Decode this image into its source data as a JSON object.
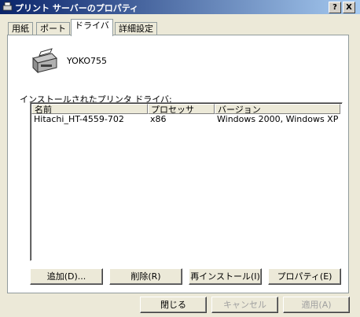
{
  "window": {
    "title": "プリント サーバーのプロパティ",
    "help_label": "?",
    "close_label": "X"
  },
  "tabs": [
    {
      "label": "用紙"
    },
    {
      "label": "ポート"
    },
    {
      "label": "ドライバ"
    },
    {
      "label": "詳細設定"
    }
  ],
  "server": {
    "name": "YOKO755",
    "icon": "printer-server-icon"
  },
  "drivers": {
    "label": "インストールされたプリンタ ドライバ:",
    "columns": [
      "名前",
      "プロセッサ",
      "バージョン"
    ],
    "rows": [
      [
        "Hitachi_HT-4559-702",
        "x86",
        "Windows 2000, Windows XP ..."
      ]
    ]
  },
  "buttons": {
    "add": "追加(D)...",
    "remove": "削除(R)",
    "reinstall": "再インストール(I)",
    "properties": "プロパティ(E)"
  },
  "footer": {
    "close": "閉じる",
    "cancel": "キャンセル",
    "apply": "適用(A)"
  }
}
